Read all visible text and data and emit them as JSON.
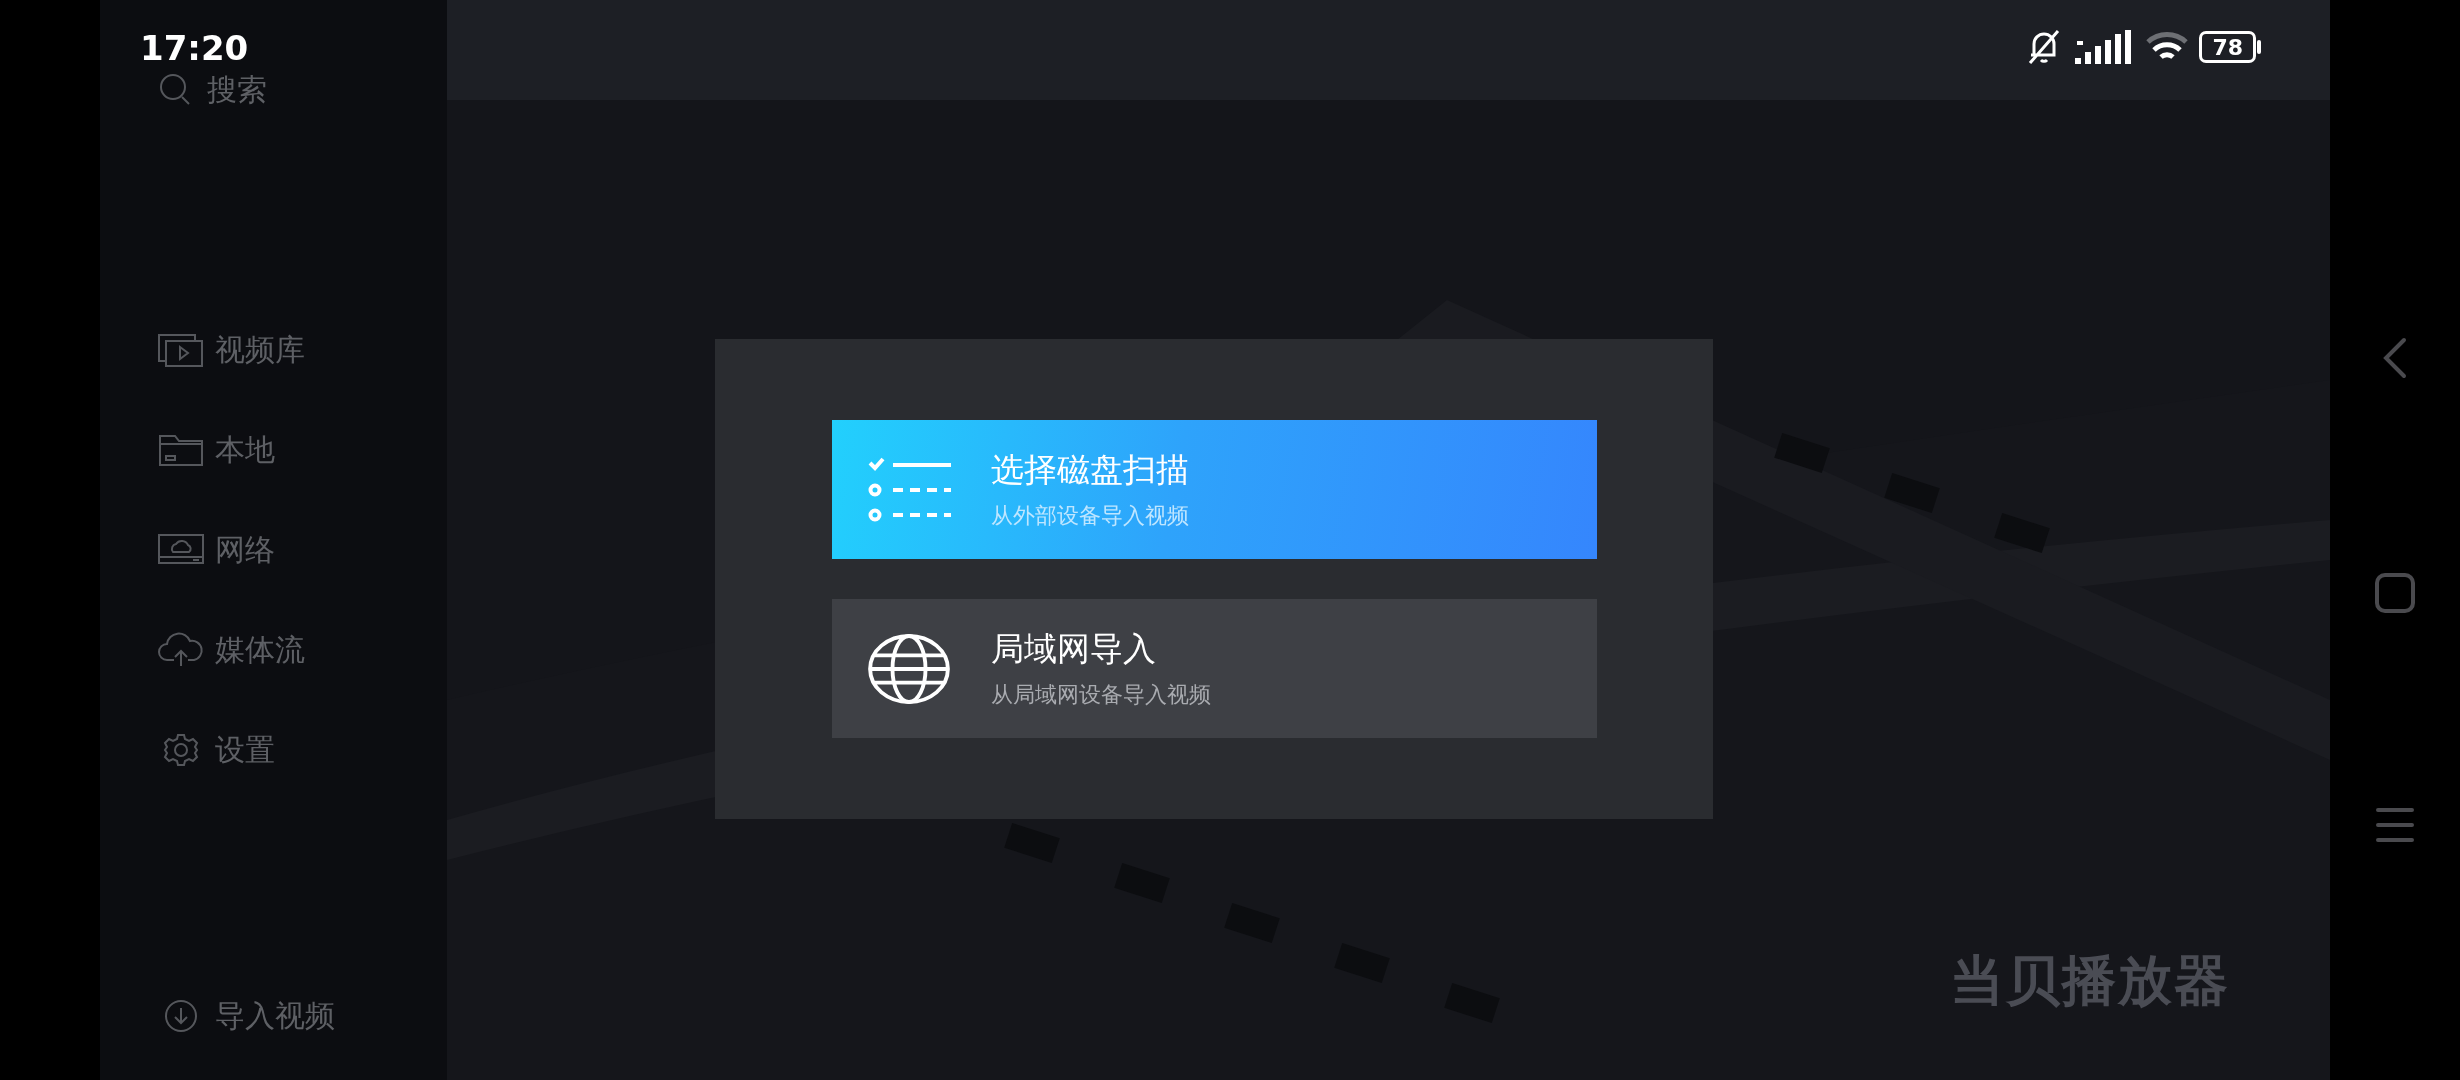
{
  "status_bar": {
    "time": "17:20",
    "battery": "78"
  },
  "sidebar": {
    "search": "搜索",
    "items": [
      {
        "label": "视频库",
        "kind": "library"
      },
      {
        "label": "本地",
        "kind": "folder"
      },
      {
        "label": "网络",
        "kind": "network"
      },
      {
        "label": "媒体流",
        "kind": "cloud"
      },
      {
        "label": "设置",
        "kind": "gear"
      }
    ],
    "footer": {
      "label": "导入视频",
      "kind": "download"
    }
  },
  "dialog": {
    "options": [
      {
        "title": "选择磁盘扫描",
        "subtitle": "从外部设备导入视频",
        "selected": true,
        "kind": "checklist"
      },
      {
        "title": "局域网导入",
        "subtitle": "从局域网设备导入视频",
        "selected": false,
        "kind": "globe"
      }
    ]
  },
  "brand": "当贝播放器"
}
